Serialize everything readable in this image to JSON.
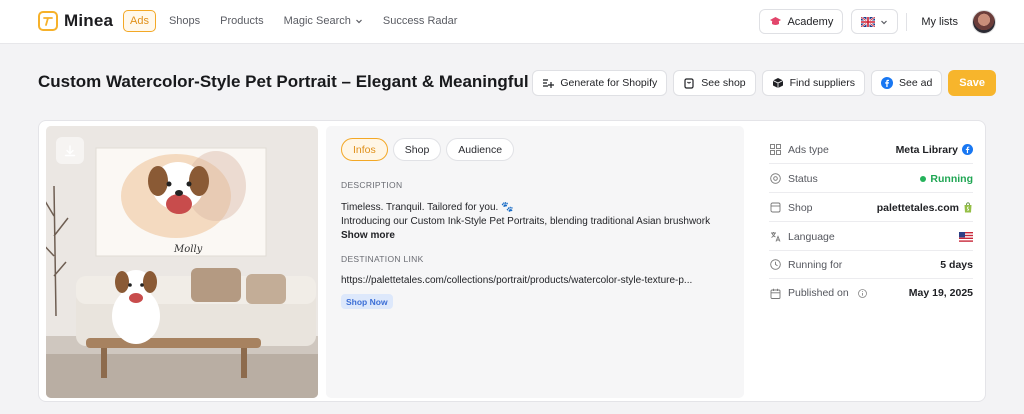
{
  "app": {
    "name": "Minea"
  },
  "nav": {
    "items": [
      {
        "label": "Ads",
        "active": true
      },
      {
        "label": "Shops",
        "active": false
      },
      {
        "label": "Products",
        "active": false
      },
      {
        "label": "Magic Search",
        "active": false,
        "dropdown": true
      },
      {
        "label": "Success Radar",
        "active": false
      }
    ],
    "academy": "Academy",
    "language_flag": "uk-flag-icon",
    "my_lists": "My lists"
  },
  "page": {
    "title": "Custom Watercolor-Style Pet Portrait – Elegant & Meaningful"
  },
  "actions": {
    "generate": "Generate for Shopify",
    "see_shop": "See shop",
    "find_suppliers": "Find suppliers",
    "see_ad": "See ad",
    "save": "Save"
  },
  "tabs": [
    "Infos",
    "Shop",
    "Audience"
  ],
  "infos": {
    "description_label": "DESCRIPTION",
    "description_line1": "Timeless. Tranquil. Tailored for you. 🐾",
    "description_line2": "Introducing our Custom Ink-Style Pet Portraits, blending traditional Asian brushwork",
    "show_more": "Show more",
    "destination_label": "DESTINATION LINK",
    "destination_url": "https://palettetales.com/collections/portrait/products/watercolor-style-texture-p...",
    "cta": "Shop Now"
  },
  "media": {
    "portrait_caption": "Molly"
  },
  "meta": [
    {
      "key": "Ads type",
      "value": "Meta Library",
      "icon": "grid-icon"
    },
    {
      "key": "Status",
      "value": "Running",
      "icon": "circle-settings-icon"
    },
    {
      "key": "Shop",
      "value": "palettetales.com",
      "icon": "shop-icon"
    },
    {
      "key": "Language",
      "value": "",
      "icon": "translate-icon"
    },
    {
      "key": "Running for",
      "value": "5 days",
      "icon": "clock-icon"
    },
    {
      "key": "Published on",
      "value": "May 19, 2025",
      "icon": "calendar-icon"
    }
  ],
  "colors": {
    "accent": "#f7b52c",
    "running": "#25b25b",
    "facebook": "#1877f2",
    "shopify": "#95bf47"
  }
}
